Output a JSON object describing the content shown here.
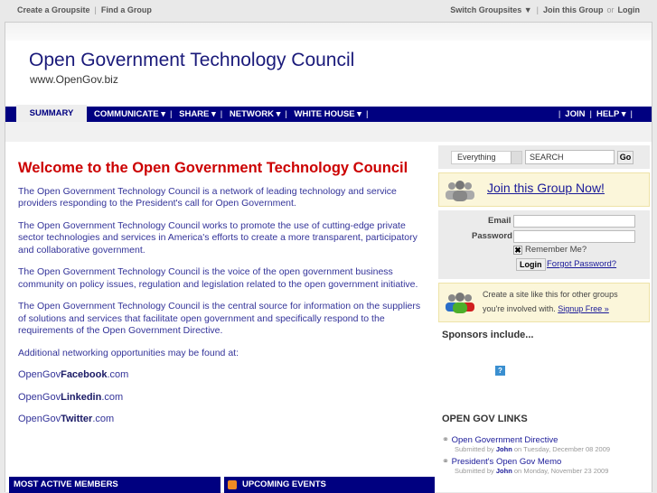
{
  "topbar": {
    "create": "Create a Groupsite",
    "find": "Find a Group",
    "switch": "Switch Groupsites ▼",
    "join": "Join this Group",
    "or": "or",
    "login": "Login"
  },
  "header": {
    "title": "Open Government Technology Council",
    "subtitle": "www.OpenGov.biz"
  },
  "nav": {
    "summary": "SUMMARY",
    "items": [
      "COMMUNICATE ▾",
      "SHARE ▾",
      "NETWORK ▾",
      "WHITE HOUSE ▾"
    ],
    "right": [
      "JOIN",
      "HELP ▾"
    ]
  },
  "main": {
    "heading": "Welcome to the Open Government Technology Council",
    "paragraphs": [
      "The Open Government Technology Council is a network of leading technology and service providers responding to the President's call for Open Government.",
      "The Open Government Technology Council works to promote the use of cutting-edge private sector technologies and services in America's efforts to create a more transparent, participatory and collaborative government.",
      "The Open Government Technology Council is the voice of the open government business community on policy issues, regulation and legislation related to the open government initiative.",
      "The Open Government Technology Council is the central source for information on the suppliers of solutions and services that facilitate open government and specifically respond to the requirements of the Open Government Directive.",
      "Additional networking opportunities may be found at:"
    ],
    "links": [
      {
        "pre": "OpenGov",
        "bold": "Facebook",
        "post": ".com"
      },
      {
        "pre": "OpenGov",
        "bold": "Linkedin",
        "post": ".com"
      },
      {
        "pre": "OpenGov",
        "bold": "Twitter",
        "post": ".com"
      }
    ],
    "boxes": [
      "MOST ACTIVE MEMBERS",
      "UPCOMING EVENTS"
    ]
  },
  "sidebar": {
    "search_scope": "Everything",
    "search_placeholder": "SEARCH",
    "go": "Go",
    "join_now": "Join this Group Now!",
    "email_label": "Email",
    "password_label": "Password",
    "remember": "Remember Me?",
    "login": "Login",
    "forgot": "Forgot Password?",
    "create_text1": "Create a site like this for other groups",
    "create_text2": "you're involved with.",
    "signup": "Signup Free »",
    "sponsors": "Sponsors include...",
    "links_heading": "OPEN GOV LINKS",
    "links": [
      {
        "title": "Open Government Directive",
        "by": "Submitted by",
        "user": "John",
        "date": "on Tuesday, December 08 2009"
      },
      {
        "title": "President's Open Gov Memo",
        "by": "Submitted by",
        "user": "John",
        "date": "on Monday, November 23 2009"
      }
    ]
  }
}
